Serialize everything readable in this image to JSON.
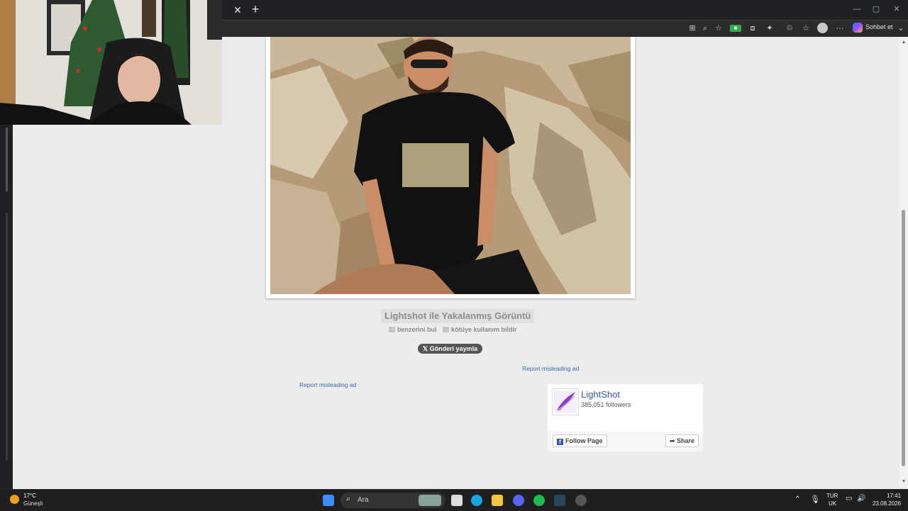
{
  "browser": {
    "close_tab": "✕",
    "new_tab": "+",
    "minimize": "—",
    "maximize": "▢",
    "close_window": "✕",
    "chat_label": "Sohbet et"
  },
  "page": {
    "caption": "Lightshot ile Yakalanmış Görüntü",
    "links": [
      "benzerini bul",
      "kötüye kullanım bildir"
    ],
    "share_button": "Gönderi yayınla",
    "report_ad_1": "Report misleading ad",
    "report_ad_2": "Report misleading ad"
  },
  "facebook": {
    "page_name": "LightShot",
    "followers": "385,051 followers",
    "follow_button": "Follow Page",
    "share_button": "Share"
  },
  "taskbar": {
    "temperature": "17°C",
    "weather": "Güneşli",
    "search_placeholder": "Ara",
    "lang_top": "TUR",
    "lang_bottom": "UK",
    "time": "17:41",
    "date": "23.08.2026"
  }
}
